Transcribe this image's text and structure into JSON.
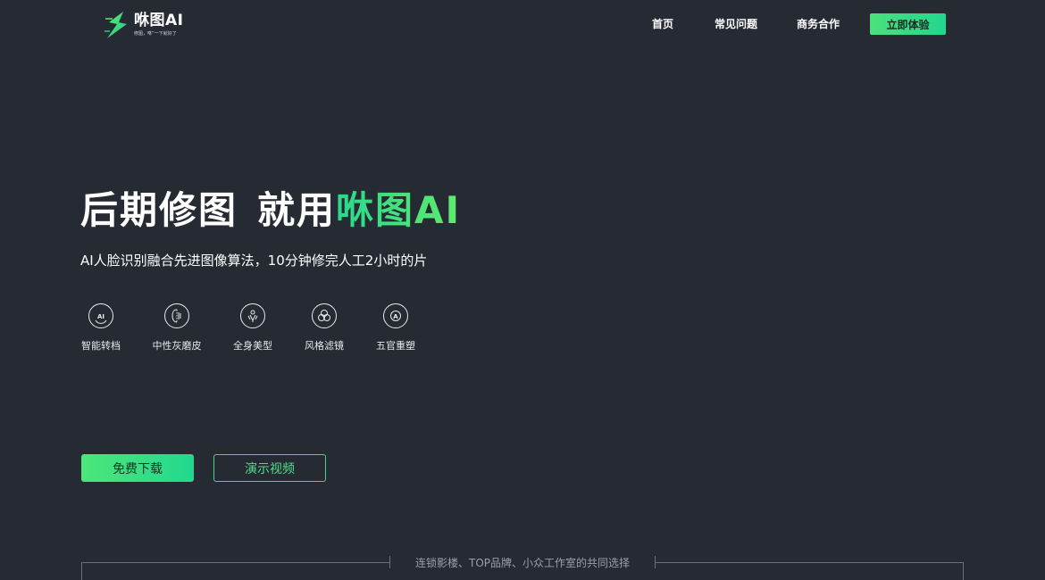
{
  "brand": {
    "name": "咻图AI",
    "slogan": "修图，咻”一下就好了"
  },
  "nav": {
    "home": "首页",
    "faq": "常见问题",
    "business": "商务合作",
    "cta": "立即体验"
  },
  "hero": {
    "title_part1": "后期修图",
    "title_part2": "就用",
    "title_highlight": "咻图AI",
    "subtitle": "AI人脸识别融合先进图像算法，10分钟修完人工2小时的片"
  },
  "features": [
    {
      "label": "智能转档",
      "icon": "ai-icon"
    },
    {
      "label": "中性灰磨皮",
      "icon": "face-icon"
    },
    {
      "label": "全身美型",
      "icon": "body-icon"
    },
    {
      "label": "风格滤镜",
      "icon": "filter-icon"
    },
    {
      "label": "五官重塑",
      "icon": "reshape-icon"
    }
  ],
  "buttons": {
    "download": "免费下载",
    "video": "演示视频"
  },
  "partners": {
    "title": "连锁影楼、TOP品牌、小众工作室的共同选择"
  },
  "colors": {
    "background": "#262a33",
    "accent_green": "#3edc7e",
    "accent_teal": "#22d68f"
  }
}
